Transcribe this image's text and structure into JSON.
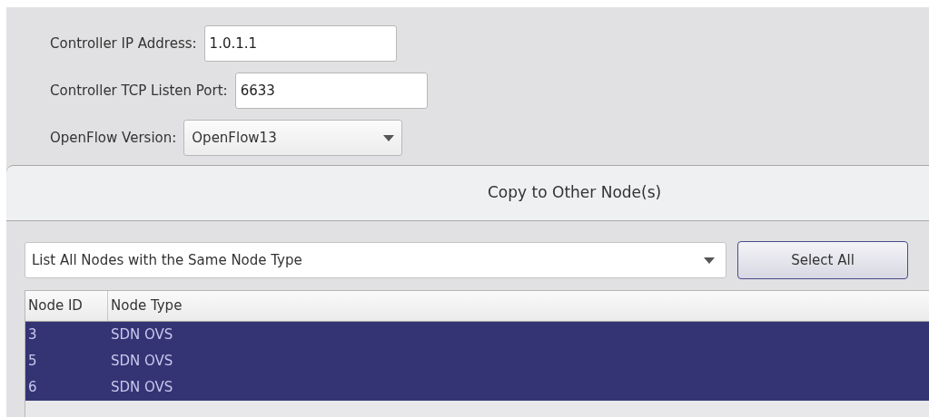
{
  "settings": [
    {
      "label": "Controller IP Address:",
      "kind": "text",
      "value": "1.0.1.1"
    },
    {
      "label": "Controller TCP Listen Port:",
      "kind": "text",
      "value": "6633"
    },
    {
      "label": "OpenFlow Version:",
      "kind": "select",
      "value": "OpenFlow13"
    }
  ],
  "copy_panel": {
    "title": "Copy to Other Node(s)",
    "filter": {
      "value": "List All Nodes with the Same Node Type"
    },
    "select_all_button": "Select All",
    "table": {
      "columns": [
        "Node ID",
        "Node Type"
      ],
      "rows": [
        {
          "cells": [
            "3",
            "SDN OVS"
          ],
          "selected": true
        },
        {
          "cells": [
            "5",
            "SDN OVS"
          ],
          "selected": true
        },
        {
          "cells": [
            "6",
            "SDN OVS"
          ],
          "selected": true
        }
      ]
    }
  }
}
